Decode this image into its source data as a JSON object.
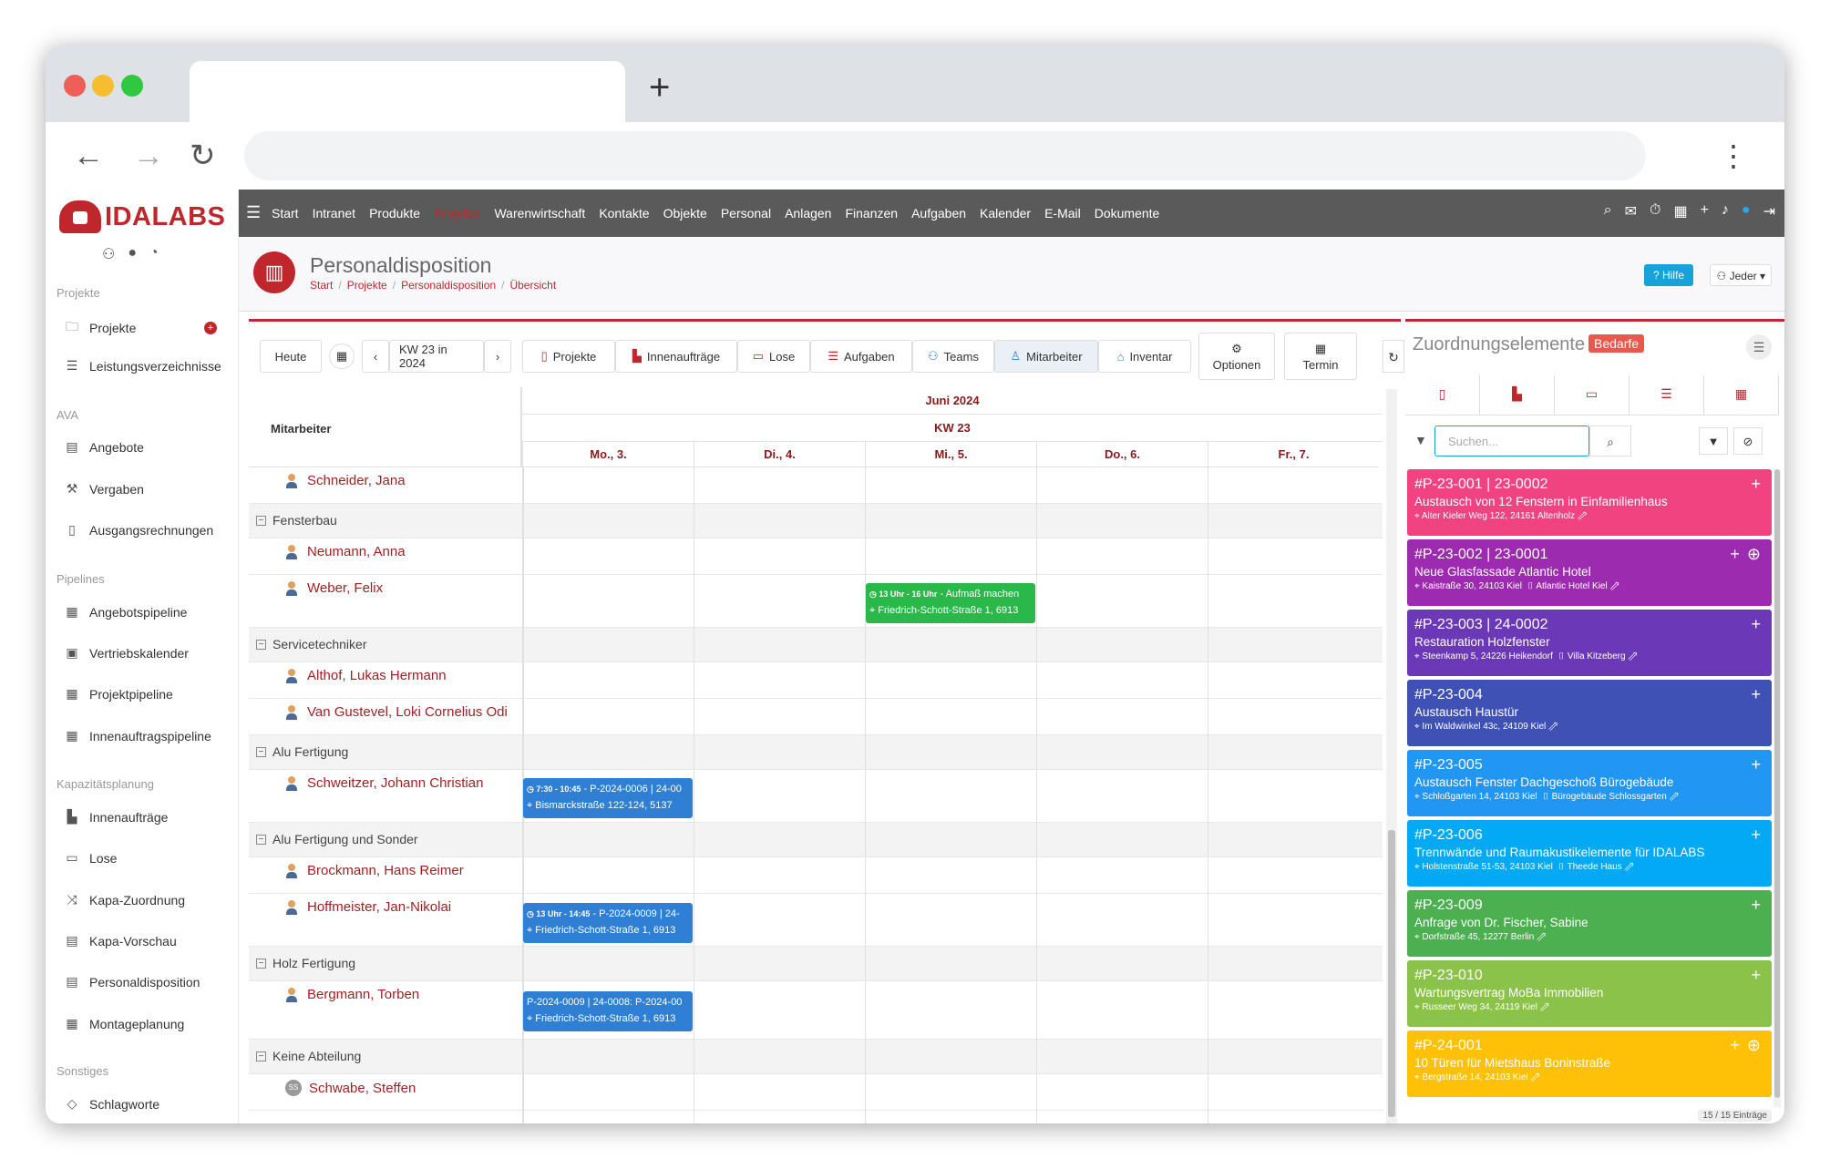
{
  "browser": {
    "newtab_glyph": "+"
  },
  "sidebar": {
    "logo": "IDALABS",
    "sections": [
      {
        "label": "Projekte",
        "top": 0
      },
      {
        "label": "AVA"
      },
      {
        "label": "Pipelines"
      },
      {
        "label": "Kapazitätsplanung"
      },
      {
        "label": "Sonstiges"
      }
    ],
    "items": [
      {
        "label": "Projekte"
      },
      {
        "label": "Leistungsverzeichnisse"
      },
      {
        "label": "Angebote"
      },
      {
        "label": "Vergaben"
      },
      {
        "label": "Ausgangsrechnungen"
      },
      {
        "label": "Angebotspipeline"
      },
      {
        "label": "Vertriebskalender"
      },
      {
        "label": "Projektpipeline"
      },
      {
        "label": "Innenauftragspipeline"
      },
      {
        "label": "Innenaufträge"
      },
      {
        "label": "Lose"
      },
      {
        "label": "Kapa-Zuordnung"
      },
      {
        "label": "Kapa-Vorschau"
      },
      {
        "label": "Personaldisposition"
      },
      {
        "label": "Montageplanung"
      },
      {
        "label": "Schlagworte"
      }
    ]
  },
  "topnav": {
    "links": [
      "Start",
      "Intranet",
      "Produkte",
      "Projekte",
      "Warenwirtschaft",
      "Kontakte",
      "Objekte",
      "Personal",
      "Anlagen",
      "Finanzen",
      "Aufgaben",
      "Kalender",
      "E-Mail",
      "Dokumente"
    ]
  },
  "header": {
    "title": "Personaldisposition",
    "breadcrumb": [
      "Start",
      "Projekte",
      "Personaldisposition",
      "Übersicht"
    ],
    "hilfe": "Hilfe",
    "jeder": "Jeder"
  },
  "toolbar": {
    "heute": "Heute",
    "week": "KW 23 in 2024",
    "tabs": [
      "Projekte",
      "Innenaufträge",
      "Lose",
      "Aufgaben",
      "Teams",
      "Mitarbeiter",
      "Inventar"
    ],
    "optionen": "Optionen",
    "termin": "Termin"
  },
  "grid": {
    "employee_header": "Mitarbeiter",
    "month": "Juni 2024",
    "week": "KW 23",
    "days": [
      "Mo., 3.",
      "Di., 4.",
      "Mi., 5.",
      "Do., 6.",
      "Fr., 7."
    ],
    "rows": [
      {
        "type": "emp",
        "name": "Schneider, Jana"
      },
      {
        "type": "group",
        "name": "Fensterbau"
      },
      {
        "type": "emp",
        "name": "Neumann, Anna"
      },
      {
        "type": "emp",
        "name": "Weber, Felix"
      },
      {
        "type": "group",
        "name": "Servicetechniker"
      },
      {
        "type": "emp",
        "name": "Althof, Lukas Hermann"
      },
      {
        "type": "emp",
        "name": "Van Gustevel, Loki Cornelius Odi"
      },
      {
        "type": "group",
        "name": "Alu Fertigung"
      },
      {
        "type": "emp",
        "name": "Schweitzer, Johann Christian"
      },
      {
        "type": "group",
        "name": "Alu Fertigung und Sonder"
      },
      {
        "type": "emp",
        "name": "Brockmann, Hans Reimer"
      },
      {
        "type": "emp",
        "name": "Hoffmeister, Jan-Nikolai"
      },
      {
        "type": "group",
        "name": "Holz Fertigung"
      },
      {
        "type": "emp",
        "name": "Bergmann, Torben"
      },
      {
        "type": "group",
        "name": "Keine Abteilung"
      },
      {
        "type": "emp",
        "name": "Schwabe, Steffen",
        "initials": "SS"
      }
    ],
    "events": [
      {
        "time": "13 Uhr - 16 Uhr",
        "title": "Aufmaß machen",
        "addr": "Friedrich-Schott-Straße 1, 6913",
        "color": "#2bb84a"
      },
      {
        "time": "7:30 - 10:45",
        "title": "P-2024-0006 | 24-00",
        "addr": "Bismarckstraße 122-124, 5137",
        "color": "#2f7fd4"
      },
      {
        "time": "13 Uhr - 14:45",
        "title": "P-2024-0009 | 24-",
        "addr": "Friedrich-Schott-Straße 1, 6913",
        "color": "#2f7fd4"
      },
      {
        "time": "",
        "title": "P-2024-0009 | 24-0008: P-2024-00",
        "addr": "Friedrich-Schott-Straße 1, 6913",
        "color": "#2f7fd4"
      }
    ]
  },
  "right": {
    "title": "Zuordnungselemente",
    "badge": "Bedarfe",
    "search_placeholder": "Suchen...",
    "count": "15 / 15 Einträge",
    "cards": [
      {
        "id": "#P-23-001 | 23-0002",
        "title": "Austausch von 12 Fenstern in Einfamilienhaus",
        "addr": "Alter Kieler Weg 122, 24161 Altenholz",
        "obj": "",
        "color": "#f0437f"
      },
      {
        "id": "#P-23-002 | 23-0001",
        "title": "Neue Glasfassade Atlantic Hotel",
        "addr": "Kaistraße 30, 24103 Kiel",
        "obj": "Atlantic Hotel Kiel",
        "color": "#9c2bb0"
      },
      {
        "id": "#P-23-003 | 24-0002",
        "title": "Restauration Holzfenster",
        "addr": "Steenkamp 5, 24226 Heikendorf",
        "obj": "Villa Kitzeberg",
        "color": "#6b39b8"
      },
      {
        "id": "#P-23-004",
        "title": "Austausch Haustür",
        "addr": "Im Waldwinkel 43c, 24109 Kiel",
        "obj": "",
        "color": "#3f51b5"
      },
      {
        "id": "#P-23-005",
        "title": "Austausch Fenster Dachgeschoß Bürogebäude",
        "addr": "Schloßgarten 14, 24103 Kiel",
        "obj": "Bürogebäude Schlossgarten",
        "color": "#2196f3"
      },
      {
        "id": "#P-23-006",
        "title": "Trennwände und Raumakustikelemente für IDALABS",
        "addr": "Holstenstraße 51-53, 24103 Kiel",
        "obj": "Theede Haus",
        "color": "#03a9f4"
      },
      {
        "id": "#P-23-009",
        "title": "Anfrage von Dr. Fischer, Sabine",
        "addr": "Dorfstraße 45, 12277 Berlin",
        "obj": "",
        "color": "#4caf50"
      },
      {
        "id": "#P-23-010",
        "title": "Wartungsvertrag MoBa Immobilien",
        "addr": "Russeer Weg 34, 24119 Kiel",
        "obj": "",
        "color": "#8bc34a"
      },
      {
        "id": "#P-24-001",
        "title": "10 Türen für Mietshaus Boninstraße",
        "addr": "Bergstraße 14, 24103 Kiel",
        "obj": "",
        "color": "#ffc107"
      }
    ]
  }
}
